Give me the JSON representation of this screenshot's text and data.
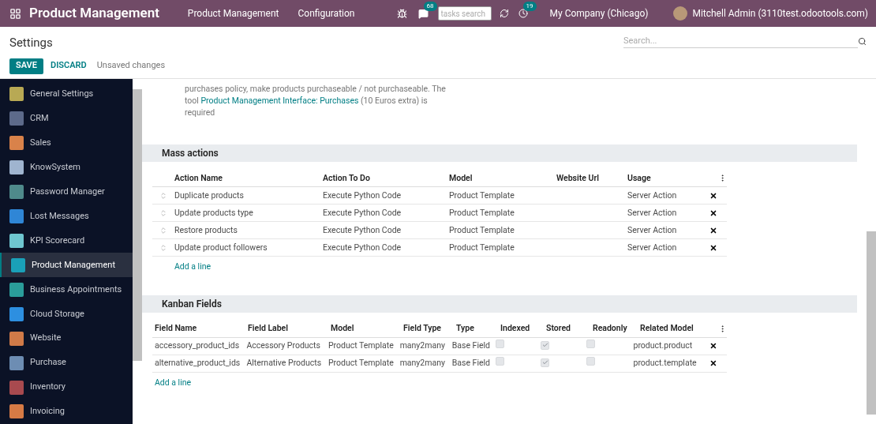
{
  "navbar": {
    "app_title": "Product Management",
    "menu": [
      "Product Management",
      "Configuration"
    ],
    "messages_badge": "68",
    "search": {
      "placeholder": "tasks search"
    },
    "activities_badge": "19",
    "company": "My Company (Chicago)",
    "user": "Mitchell Admin (3110test.odootools.com)"
  },
  "control_panel": {
    "title": "Settings",
    "search": {
      "placeholder": "Search..."
    },
    "buttons": [
      "SAVE",
      "DISCARD"
    ],
    "status": "Unsaved changes"
  },
  "sidebar": {
    "items": [
      {
        "label": "General Settings",
        "color": "#b8a954",
        "selected": false
      },
      {
        "label": "CRM",
        "color": "#5d6a8a",
        "selected": false
      },
      {
        "label": "Sales",
        "color": "#d9824a",
        "selected": false
      },
      {
        "label": "KnowSystem",
        "color": "#9fb4cf",
        "selected": false
      },
      {
        "label": "Password Manager",
        "color": "#4f8a8b",
        "selected": false
      },
      {
        "label": "Lost Messages",
        "color": "#2f86d6",
        "selected": false
      },
      {
        "label": "KPI Scorecard",
        "color": "#6ec6d0",
        "selected": false
      },
      {
        "label": "Product Management",
        "color": "#1aa0b8",
        "selected": true
      },
      {
        "label": "Business Appointments",
        "color": "#2a9d9a",
        "selected": false
      },
      {
        "label": "Cloud Storage",
        "color": "#2d8fe0",
        "selected": false
      },
      {
        "label": "Website",
        "color": "#d07a48",
        "selected": false
      },
      {
        "label": "Purchase",
        "color": "#6d8db3",
        "selected": false
      },
      {
        "label": "Inventory",
        "color": "#a84a4f",
        "selected": false
      },
      {
        "label": "Invoicing",
        "color": "#d67a45",
        "selected": false
      }
    ]
  },
  "description": {
    "text_before": "purchases policy, make products purchaseable / not purchaseable. The tool",
    "link": "Product Management Interface: Purchases",
    "text_after": "(10 Euros extra) is required"
  },
  "mass_actions": {
    "title": "Mass actions",
    "columns": [
      "Action Name",
      "Action To Do",
      "Model",
      "Website Url",
      "Usage"
    ],
    "rows": [
      [
        "Duplicate products",
        "Execute Python Code",
        "Product Template",
        "",
        "Server Action"
      ],
      [
        "Update products type",
        "Execute Python Code",
        "Product Template",
        "",
        "Server Action"
      ],
      [
        "Restore products",
        "Execute Python Code",
        "Product Template",
        "",
        "Server Action"
      ],
      [
        "Update product followers",
        "Execute Python Code",
        "Product Template",
        "",
        "Server Action"
      ]
    ],
    "add_line": "Add a line"
  },
  "kanban_fields": {
    "title": "Kanban Fields",
    "columns": [
      "Field Name",
      "Field Label",
      "Model",
      "Field Type",
      "Type",
      "Indexed",
      "Stored",
      "Readonly",
      "Related Model"
    ],
    "rows": [
      {
        "field_name": "accessory_product_ids",
        "field_label": "Accessory Products",
        "model": "Product Template",
        "field_type": "many2many",
        "type": "Base Field",
        "indexed": false,
        "stored": true,
        "readonly": false,
        "related_model": "product.product"
      },
      {
        "field_name": "alternative_product_ids",
        "field_label": "Alternative Products",
        "model": "Product Template",
        "field_type": "many2many",
        "type": "Base Field",
        "indexed": false,
        "stored": true,
        "readonly": false,
        "related_model": "product.template"
      }
    ],
    "add_line": "Add a line"
  }
}
